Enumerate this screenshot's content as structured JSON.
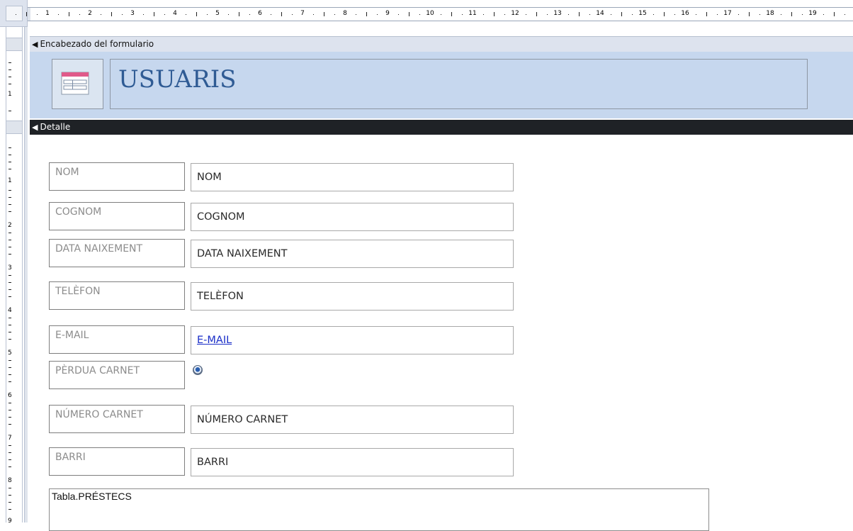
{
  "ruler": {
    "horizontal_marks": [
      "1",
      "2",
      "3",
      "4",
      "5",
      "6",
      "7",
      "8",
      "9",
      "10",
      "11",
      "12",
      "13",
      "14",
      "15",
      "16",
      "17",
      "18",
      "19"
    ],
    "vertical_marks": [
      "1",
      "1",
      "2",
      "3",
      "4",
      "5",
      "6",
      "7",
      "8",
      "9"
    ]
  },
  "sections": {
    "header_label": "Encabezado del formulario",
    "detail_label": "Detalle"
  },
  "header": {
    "title": "USUARIS",
    "icon": "form-icon"
  },
  "fields": [
    {
      "label": "NOM",
      "value": "NOM"
    },
    {
      "label": "COGNOM",
      "value": "COGNOM"
    },
    {
      "label": "DATA NAIXEMENT",
      "value": "DATA NAIXEMENT"
    },
    {
      "label": "TELÈFON",
      "value": "TELÈFON"
    },
    {
      "label": "E-MAIL",
      "value": "E-MAIL"
    },
    {
      "label": "PÈRDUA CARNET"
    },
    {
      "label": "NÚMERO CARNET",
      "value": "NÚMERO CARNET"
    },
    {
      "label": "BARRI",
      "value": "BARRI"
    }
  ],
  "subform": {
    "label": "Tabla.PRÉSTECS"
  },
  "colors": {
    "header_background": "#c6d7ee",
    "title_color": "#2f5b94",
    "detail_bar": "#1f2226",
    "link": "#1a2ec8"
  }
}
